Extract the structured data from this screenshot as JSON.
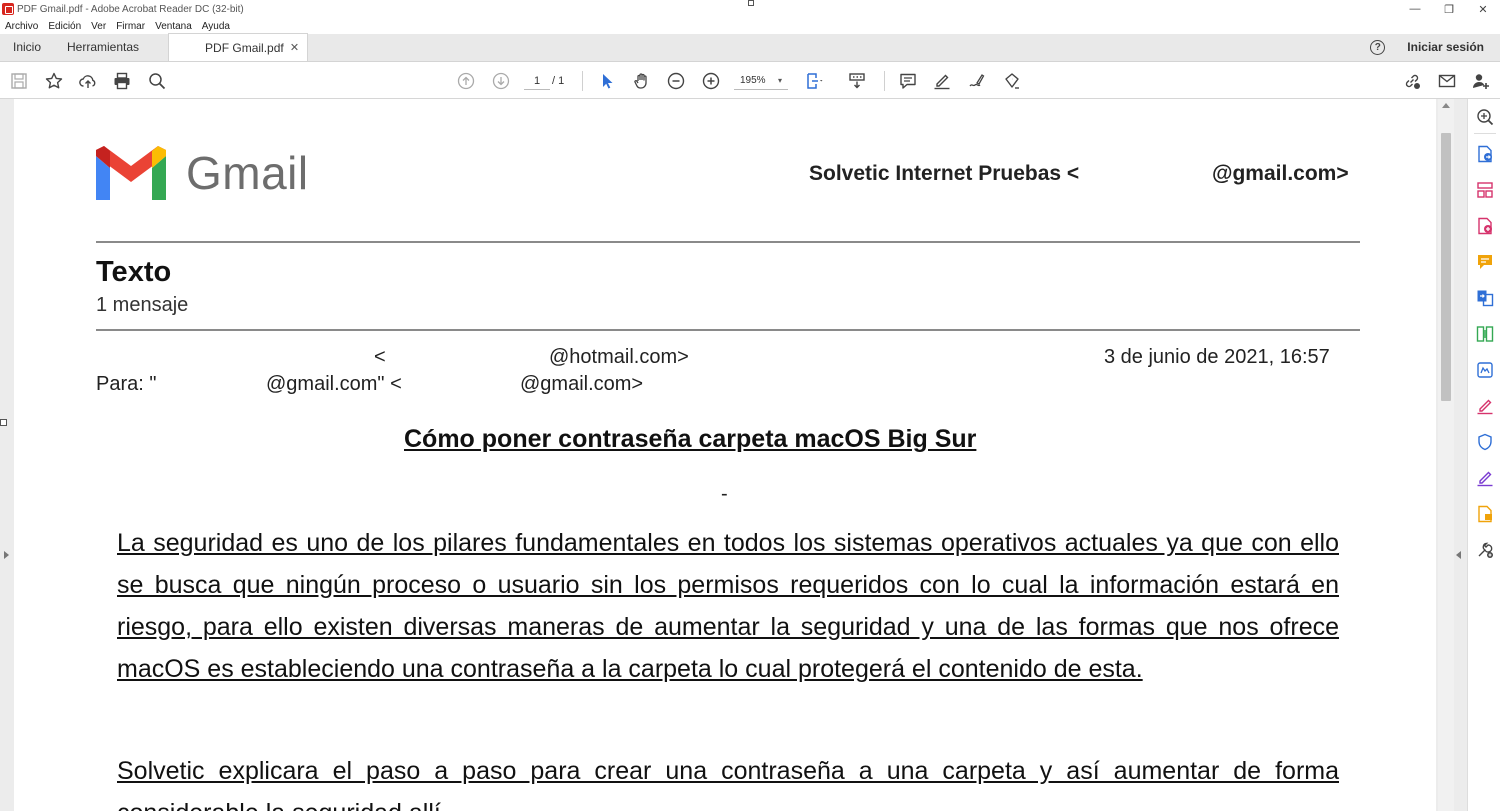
{
  "window": {
    "title": "PDF Gmail.pdf - Adobe Acrobat Reader DC (32-bit)",
    "controls": {
      "minimize": "—",
      "restore": "❐",
      "close": "✕"
    }
  },
  "menu": [
    "Archivo",
    "Edición",
    "Ver",
    "Firmar",
    "Ventana",
    "Ayuda"
  ],
  "tabs": {
    "home": "Inicio",
    "tools": "Herramientas",
    "document": "PDF Gmail.pdf",
    "close": "✕",
    "help": "?",
    "signin": "Iniciar sesión"
  },
  "toolbar": {
    "page_current": "1",
    "page_total": "/  1",
    "zoom": "195%",
    "zoom_caret": "▾"
  },
  "email": {
    "logo_text": "Gmail",
    "sender_name": "Solvetic Internet Pruebas <",
    "sender_domain": "@gmail.com>",
    "subject": "Texto",
    "message_count": "1 mensaje",
    "from_open": "<",
    "from_domain": "@hotmail.com>",
    "date": "3 de junio de 2021, 16:57",
    "to_label": "Para: \"",
    "to_addr1": "@gmail.com\" <",
    "to_addr2": "@gmail.com>",
    "heading": "Cómo poner contraseña carpeta macOS Big Sur ",
    "dash": "-",
    "paragraph1": "La seguridad es uno de los pilares fundamentales en todos los sistemas operativos actuales ya que con ello se busca que ningún proceso o usuario sin los permisos requeridos con lo cual la información estará en riesgo, para ello existen diversas maneras de aumentar la seguridad y una de las formas que nos ofrece macOS es estableciendo una contraseña a la carpeta lo cual protegerá el contenido de esta. ",
    "paragraph2": "Solvetic explicara el paso a paso para crear una contraseña a una carpeta y así aumentar de forma considerable la seguridad allí."
  },
  "colors": {
    "gmail_red": "#EA4335",
    "gmail_blue": "#4285F4",
    "gmail_green": "#34A853",
    "gmail_yellow": "#FBBC04",
    "accent_pink": "#d6336c",
    "accent_blue": "#2f6fd6"
  }
}
